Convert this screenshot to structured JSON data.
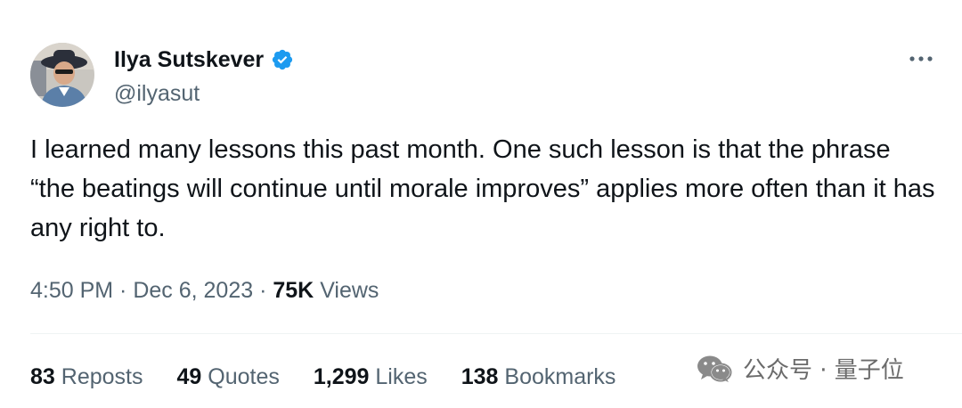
{
  "author": {
    "display_name": "Ilya Sutskever",
    "handle": "@ilyasut",
    "verified": true,
    "avatar_icon": "profile-photo",
    "verified_icon": "verified-badge-icon"
  },
  "more_icon": "ellipsis-icon",
  "tweet": {
    "text": "I learned many lessons this past month. One such lesson is that the phrase “the beatings will continue until morale improves” applies more often than it has any right to."
  },
  "meta": {
    "time": "4:50 PM",
    "sep1": " · ",
    "date": "Dec 6, 2023",
    "sep2": " · ",
    "views_count": "75K",
    "views_label": " Views"
  },
  "stats": [
    {
      "num": "83",
      "label": " Reposts"
    },
    {
      "num": "49",
      "label": " Quotes"
    },
    {
      "num": "1,299",
      "label": " Likes"
    },
    {
      "num": "138",
      "label": " Bookmarks"
    }
  ],
  "watermark": {
    "text": "公众号 · 量子位",
    "icon": "wechat-icon"
  },
  "colors": {
    "text": "#0f1419",
    "secondary": "#536471",
    "verified": "#1d9bf0",
    "divider": "#eff3f4"
  }
}
